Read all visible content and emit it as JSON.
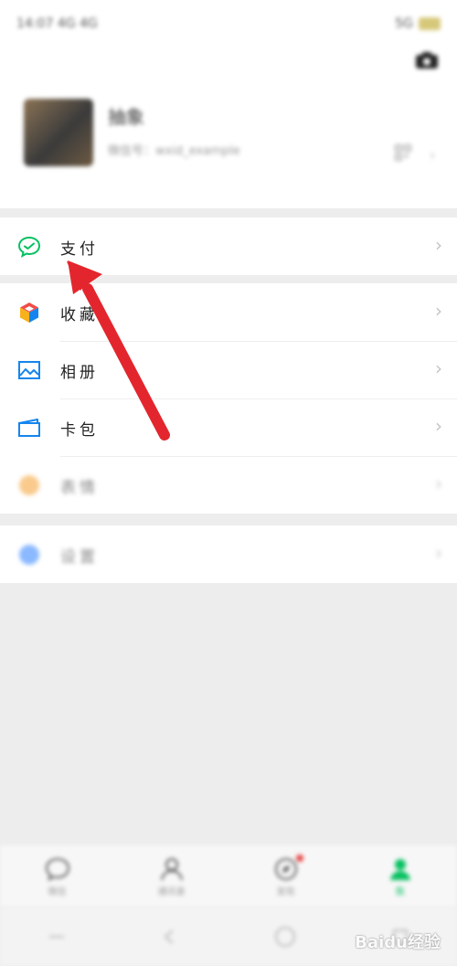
{
  "status_bar": {
    "left_text": "14:07 4G 4G",
    "right_text": "5G"
  },
  "profile": {
    "name": "抽象",
    "id_text": "微信号：wxid_example",
    "arrow": "›"
  },
  "menu": {
    "pay": {
      "label": "支付",
      "icon": "wechat-pay-icon",
      "color": "#07c160"
    },
    "favorites": {
      "label": "收藏",
      "icon": "cube-icon"
    },
    "album": {
      "label": "相册",
      "icon": "image-icon",
      "color": "#1485ee"
    },
    "cards": {
      "label": "卡包",
      "icon": "wallet-icon",
      "color": "#1485ee"
    },
    "stickers": {
      "label": "表情",
      "icon": "smile-icon",
      "color": "#f7b35b"
    },
    "settings": {
      "label": "设置",
      "icon": "gear-icon",
      "color": "#5a9bff"
    },
    "chevron": "›"
  },
  "annotation": {
    "arrow_color": "#e3262d"
  },
  "tabbar": {
    "tabs": [
      {
        "label": "微信",
        "icon": "chat-icon"
      },
      {
        "label": "通讯录",
        "icon": "contacts-icon"
      },
      {
        "label": "发现",
        "icon": "compass-icon"
      },
      {
        "label": "我",
        "icon": "me-icon",
        "active": true
      }
    ],
    "active_color": "#07c160"
  },
  "watermark": "Baidu经验"
}
